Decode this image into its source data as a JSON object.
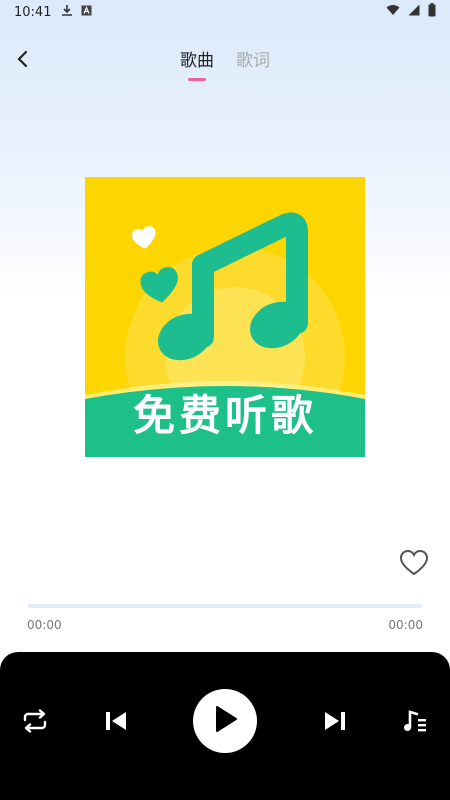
{
  "status_bar": {
    "time": "10:41",
    "left_icons": [
      "download-icon",
      "text-a-icon"
    ],
    "right_icons": [
      "wifi-icon",
      "signal-icon",
      "battery-icon"
    ]
  },
  "header": {
    "back_icon": "chevron-left-icon",
    "tabs": [
      {
        "label": "歌曲",
        "active": true
      },
      {
        "label": "歌词",
        "active": false
      }
    ]
  },
  "album": {
    "caption": "免费听歌",
    "icon": "music-note-icon"
  },
  "favorite_icon": "heart-outline-icon",
  "progress": {
    "current": "00:00",
    "total": "00:00",
    "fraction": 0
  },
  "controls": {
    "icons": [
      "repeat-icon",
      "previous-icon",
      "play-icon",
      "next-icon",
      "playlist-icon"
    ]
  },
  "colors": {
    "accent": "#f0609a",
    "album_yellow": "#fdd500",
    "album_green": "#1ec08a",
    "control_bar": "#000000"
  }
}
